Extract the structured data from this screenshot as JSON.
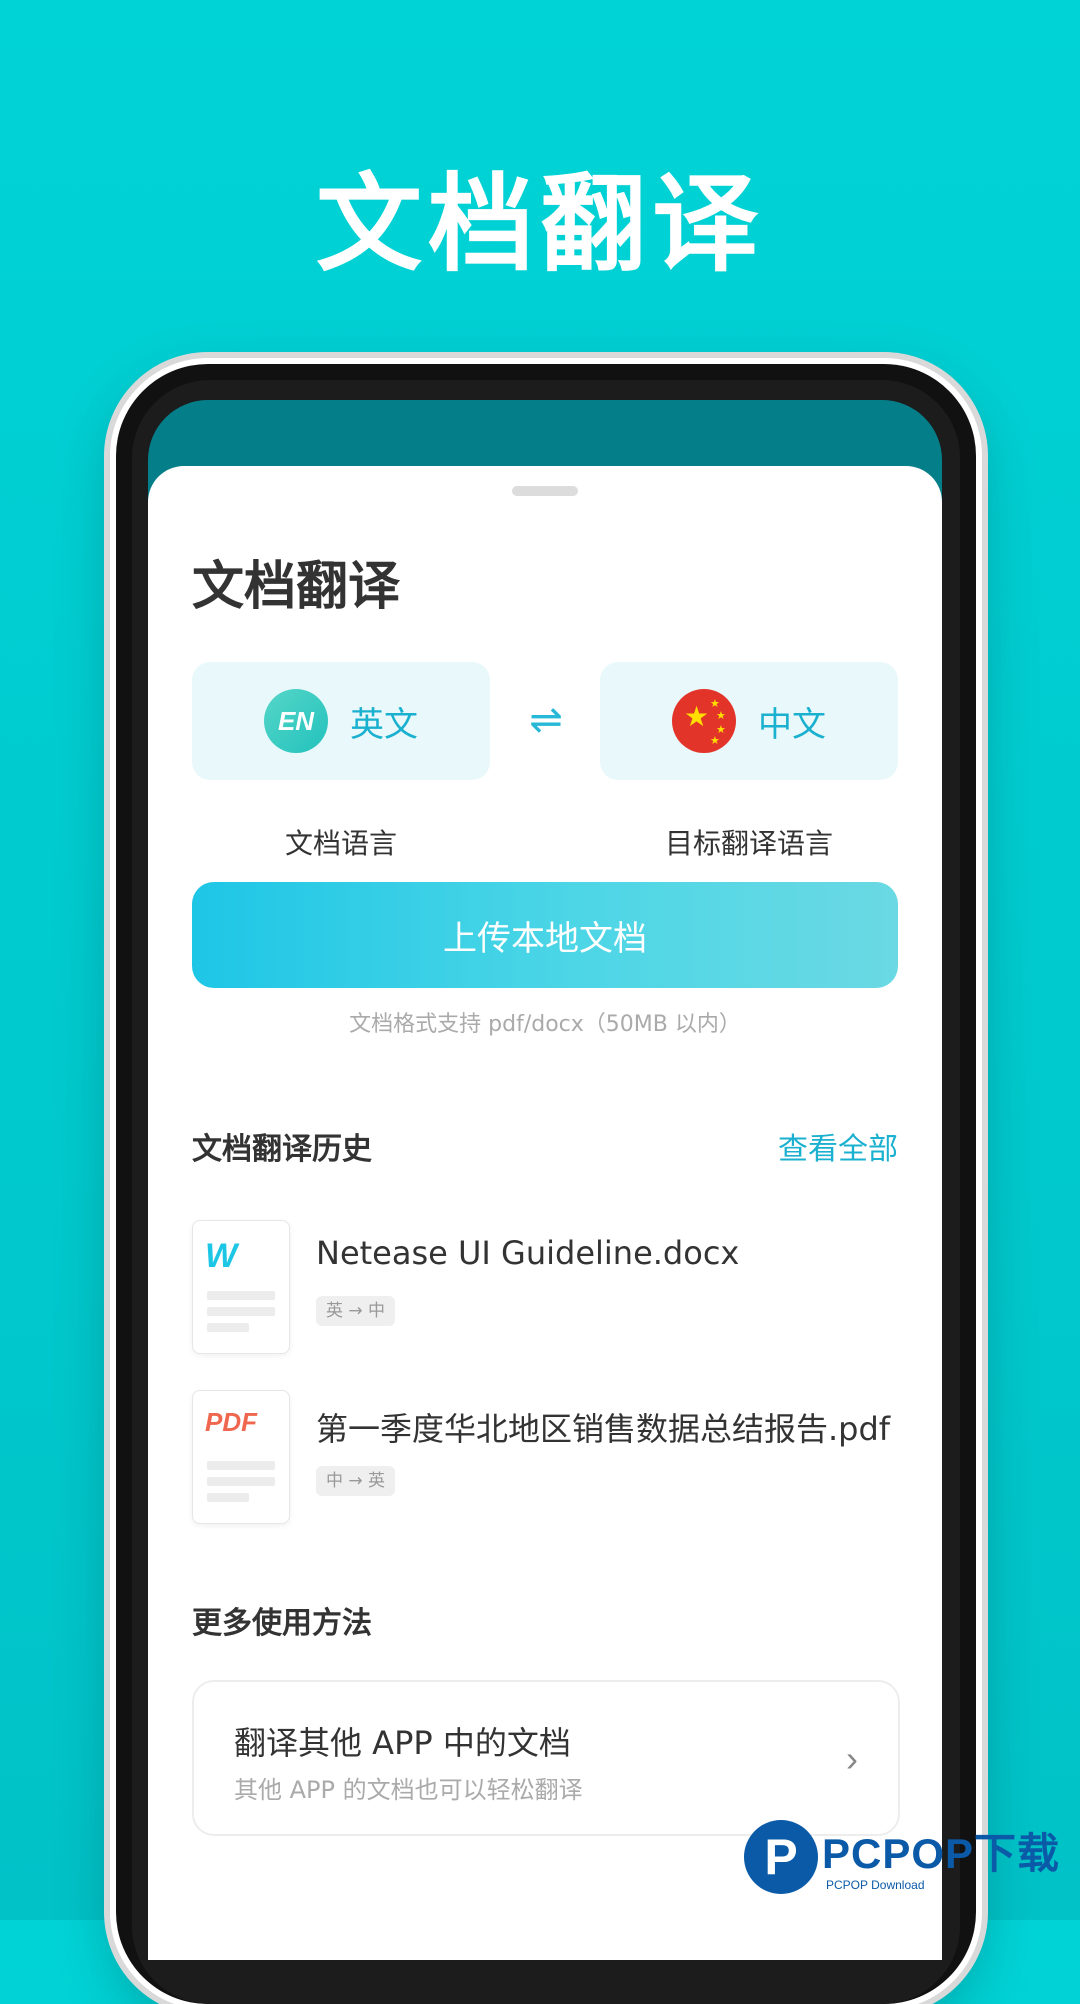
{
  "promo": {
    "title": "文档翻译"
  },
  "sheet": {
    "title": "文档翻译"
  },
  "languages": {
    "source": {
      "badge": "EN",
      "name": "英文",
      "caption": "文档语言"
    },
    "target": {
      "name": "中文",
      "caption": "目标翻译语言",
      "flag_icon": "china-flag-icon"
    },
    "swap_icon": "swap-arrows-icon"
  },
  "upload": {
    "button_label": "上传本地文档",
    "hint": "文档格式支持 pdf/docx（50MB 以内）"
  },
  "history": {
    "title": "文档翻译历史",
    "view_all": "查看全部",
    "items": [
      {
        "badge": "W",
        "name": "Netease UI Guideline.docx",
        "tag": "英 → 中"
      },
      {
        "badge": "PDF",
        "name": "第一季度华北地区销售数据总结报告.pdf",
        "tag": "中 → 英"
      }
    ]
  },
  "more": {
    "title": "更多使用方法",
    "card_title": "翻译其他 APP 中的文档",
    "card_subtitle": "其他 APP 的文档也可以轻松翻译"
  },
  "watermark": {
    "text": "PCPOP下载",
    "sub": "PCPOP Download"
  },
  "colors": {
    "accent": "#1ab0cf",
    "background": "#00cdd1",
    "pdf": "#f0674f"
  }
}
